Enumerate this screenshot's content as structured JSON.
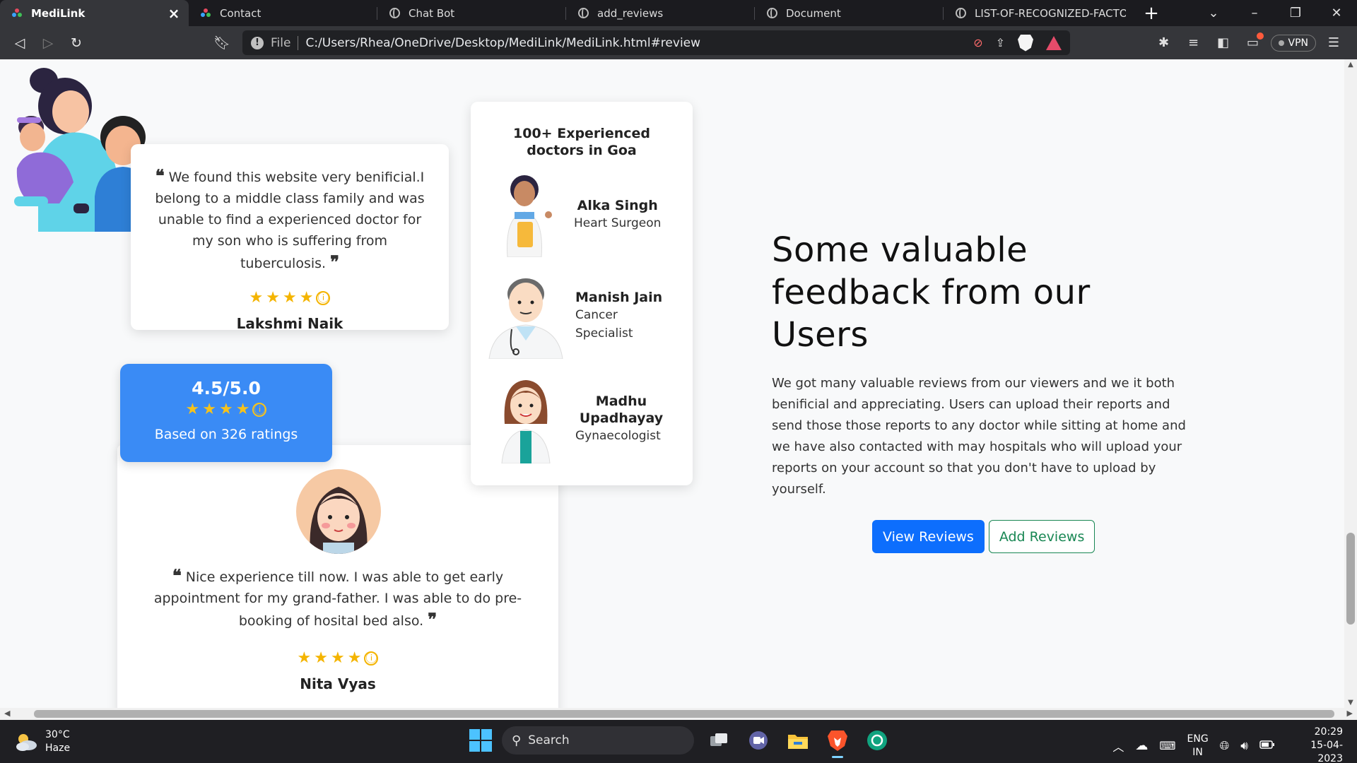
{
  "browser": {
    "tabs": [
      {
        "title": "MediLink",
        "active": true
      },
      {
        "title": "Contact",
        "active": false
      },
      {
        "title": "Chat Bot",
        "active": false
      },
      {
        "title": "add_reviews",
        "active": false
      },
      {
        "title": "Document",
        "active": false
      },
      {
        "title": "LIST-OF-RECOGNIZED-FACTORY",
        "active": false
      }
    ],
    "address": {
      "scheme_label": "File",
      "url": "C:/Users/Rhea/OneDrive/Desktop/MediLink/MediLink.html#review"
    },
    "vpn_label": "VPN"
  },
  "reviews": [
    {
      "text": "We found this website very benificial.I belong to a middle class family and was unable to find a experienced doctor for my son who is suffering from tuberculosis.",
      "name": "Lakshmi Naik",
      "rating": 4
    },
    {
      "text": "Nice experience till now. I was able to get early appointment for my grand-father. I was able to do pre-booking of hosital bed also.",
      "name": "Nita Vyas",
      "rating": 4
    }
  ],
  "rating_summary": {
    "score": "4.5/5.0",
    "based_on": "Based on 326 ratings",
    "stars": 4
  },
  "doctors_card": {
    "heading": "100+ Experienced doctors in Goa",
    "doctors": [
      {
        "name": "Alka Singh",
        "specialty": "Heart Surgeon"
      },
      {
        "name": "Manish Jain",
        "specialty": "Cancer Specialist"
      },
      {
        "name": "Madhu Upadhayay",
        "specialty": "Gynaecologist"
      }
    ]
  },
  "feedback": {
    "title": "Some valuable feedback from our Users",
    "body": "We got many valuable reviews from our viewers and we it both benificial and appreciating. Users can upload their reports and send those those reports to any doctor while sitting at home and we have also contacted with may hospitals who will upload your reports on your account so that you don't have to upload by yourself.",
    "view_button": "View Reviews",
    "add_button": "Add Reviews"
  },
  "colors": {
    "primary": "#0d6efd",
    "success": "#198754",
    "rating_box": "#3a8bf5",
    "star": "#f4b400"
  },
  "taskbar": {
    "weather_temp": "30°C",
    "weather_desc": "Haze",
    "search_label": "Search",
    "lang_top": "ENG",
    "lang_bottom": "IN",
    "time": "20:29",
    "date": "15-04-2023"
  }
}
